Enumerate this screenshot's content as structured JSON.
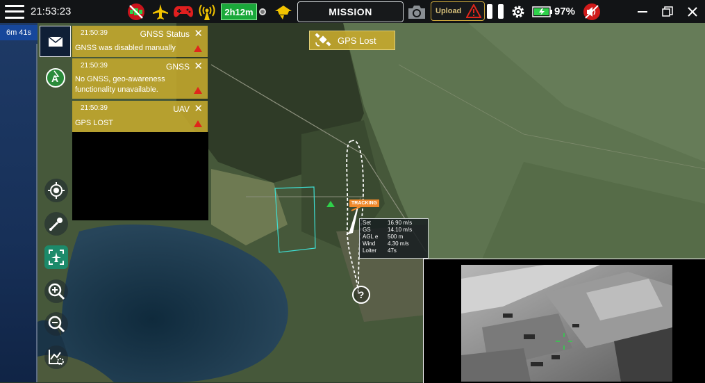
{
  "topbar": {
    "clock": "21:53:23",
    "flight_time": "2h12m",
    "mission_label": "MISSION",
    "upload_label": "Upload",
    "battery_percent": "97%",
    "colors": {
      "ok": "#1aa83a",
      "alert": "#e0261b",
      "warn": "#f2c300",
      "bg": "#121416"
    }
  },
  "sidebar": {
    "timer": "6m 41s"
  },
  "notifications": [
    {
      "time": "21:50:39",
      "title": "GNSS Status",
      "message": "GNSS was disabled manually"
    },
    {
      "time": "21:50:39",
      "title": "GNSS",
      "message": "No GNSS, geo-awareness functionality unavailable."
    },
    {
      "time": "21:50:39",
      "title": "UAV",
      "message": "GPS LOST"
    }
  ],
  "map": {
    "gps_banner": "GPS Lost",
    "tracking_label": "TRACKING",
    "telemetry": [
      {
        "key": "Set",
        "value": "16.90 m/s"
      },
      {
        "key": "GS",
        "value": "14.10 m/s"
      },
      {
        "key": "AGL e",
        "value": "500 m"
      },
      {
        "key": "Wind",
        "value": "4.30 m/s"
      },
      {
        "key": "Loiter",
        "value": "47s"
      }
    ],
    "waypoint_symbol": "?"
  },
  "icons": {
    "menu": "menu-icon",
    "gps_off": "gps-off-icon",
    "aircraft": "aircraft-icon",
    "gamepad": "gamepad-icon",
    "signal": "signal-icon",
    "tag": "tag-icon",
    "camera": "camera-icon",
    "warning": "warning-icon",
    "gear": "gear-icon",
    "battery": "battery-icon",
    "mute": "mute-icon",
    "minimize": "minimize-icon",
    "restore": "restore-icon",
    "close": "close-icon",
    "mail": "mail-icon",
    "locate": "locate-icon",
    "drone_link": "drone-link-icon",
    "center": "center-icon",
    "zoom_in": "zoom-in-icon",
    "zoom_out": "zoom-out-icon",
    "chart_settings": "chart-settings-icon"
  }
}
